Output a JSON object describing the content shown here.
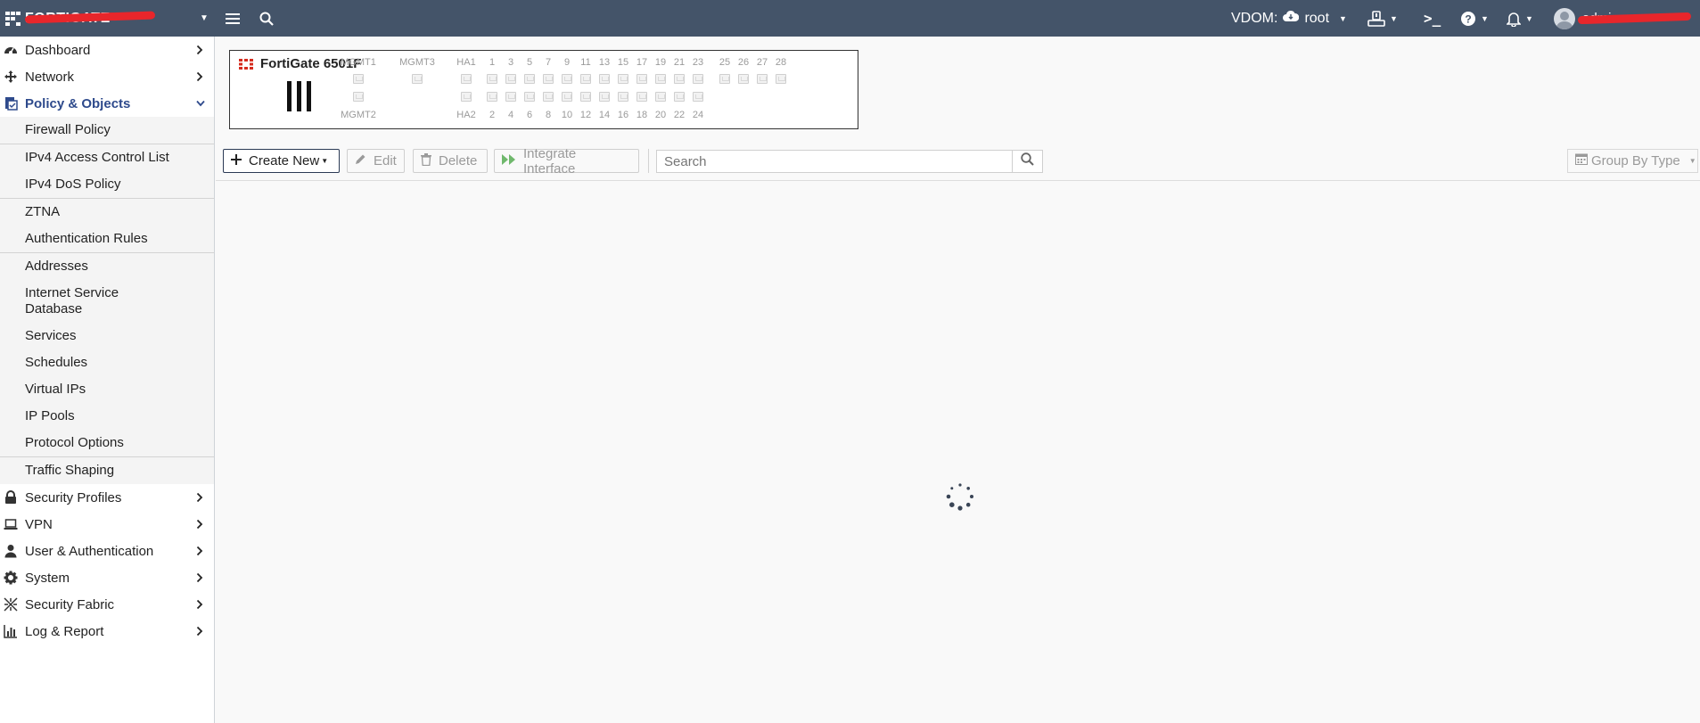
{
  "topbar": {
    "brand_name": "FORTIGATE",
    "vdom_label": "VDOM:",
    "vdom_value": "root",
    "user_name": "admin",
    "colors": {
      "bg": "#445469",
      "redaction": "#e8262b"
    }
  },
  "sidebar": {
    "items": [
      {
        "label": "Dashboard",
        "icon": "dashboard-icon"
      },
      {
        "label": "Network",
        "icon": "network-icon"
      },
      {
        "label": "Policy & Objects",
        "icon": "policy-icon",
        "expanded": true
      },
      {
        "label": "Security Profiles",
        "icon": "lock-icon"
      },
      {
        "label": "VPN",
        "icon": "laptop-icon"
      },
      {
        "label": "User & Authentication",
        "icon": "user-icon"
      },
      {
        "label": "System",
        "icon": "gear-icon"
      },
      {
        "label": "Security Fabric",
        "icon": "fabric-icon"
      },
      {
        "label": "Log & Report",
        "icon": "chart-icon"
      }
    ],
    "subitems": [
      "Firewall Policy",
      "IPv4 Access Control List",
      "IPv4 DoS Policy",
      "ZTNA",
      "Authentication Rules",
      "Addresses",
      "Internet Service Database",
      "Services",
      "Schedules",
      "Virtual IPs",
      "IP Pools",
      "Protocol Options",
      "Traffic Shaping"
    ]
  },
  "device": {
    "title": "FortiGate 6501F",
    "mgmt_top": [
      "MGMT1",
      "MGMT3",
      "HA1"
    ],
    "mgmt_bottom": [
      "MGMT2",
      "HA2"
    ],
    "ports_top": [
      "1",
      "3",
      "5",
      "7",
      "9",
      "11",
      "13",
      "15",
      "17",
      "19",
      "21",
      "23"
    ],
    "ports_bottom": [
      "2",
      "4",
      "6",
      "8",
      "10",
      "12",
      "14",
      "16",
      "18",
      "20",
      "22",
      "24"
    ],
    "ports_extra": [
      "25",
      "26",
      "27",
      "28"
    ]
  },
  "toolbar": {
    "create_new": "Create New",
    "edit": "Edit",
    "delete": "Delete",
    "integrate": "Integrate Interface",
    "search_placeholder": "Search",
    "group_by": "Group By Type"
  }
}
